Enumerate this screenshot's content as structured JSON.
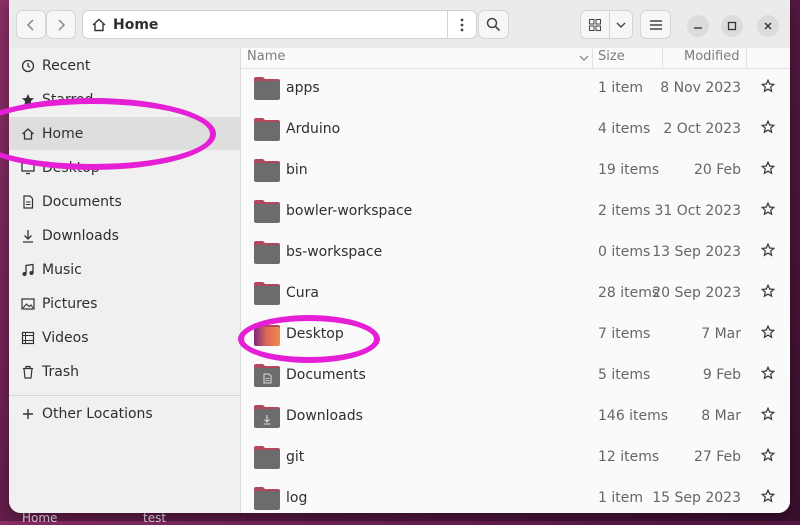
{
  "desktop": {
    "labels": [
      "Home",
      "test"
    ]
  },
  "header": {
    "title": "Home",
    "back_icon": "chevron-left-icon",
    "forward_icon": "chevron-right-icon",
    "search_icon": "search-icon",
    "view_icon": "grid-view-icon",
    "view_dropdown_icon": "chevron-down-icon",
    "menu_icon": "hamburger-icon",
    "window_controls": [
      "minimize",
      "maximize",
      "close"
    ]
  },
  "sidebar": {
    "items": [
      {
        "label": "Recent",
        "icon": "clock-icon"
      },
      {
        "label": "Starred",
        "icon": "star-icon"
      },
      {
        "label": "Home",
        "icon": "home-icon",
        "active": true
      },
      {
        "label": "Desktop",
        "icon": "desktop-icon"
      },
      {
        "label": "Documents",
        "icon": "document-icon"
      },
      {
        "label": "Downloads",
        "icon": "download-icon"
      },
      {
        "label": "Music",
        "icon": "music-icon"
      },
      {
        "label": "Pictures",
        "icon": "picture-icon"
      },
      {
        "label": "Videos",
        "icon": "video-icon"
      },
      {
        "label": "Trash",
        "icon": "trash-icon"
      }
    ],
    "other_locations": "Other Locations"
  },
  "list": {
    "columns": {
      "name": "Name",
      "size": "Size",
      "modified": "Modified"
    },
    "rows": [
      {
        "name": "apps",
        "size": "1 item",
        "modified": "8 Nov 2023",
        "kind": "folder"
      },
      {
        "name": "Arduino",
        "size": "4 items",
        "modified": "2 Oct 2023",
        "kind": "folder"
      },
      {
        "name": "bin",
        "size": "19 items",
        "modified": "20 Feb",
        "kind": "folder"
      },
      {
        "name": "bowler-workspace",
        "size": "2 items",
        "modified": "31 Oct 2023",
        "kind": "folder"
      },
      {
        "name": "bs-workspace",
        "size": "0 items",
        "modified": "13 Sep 2023",
        "kind": "folder"
      },
      {
        "name": "Cura",
        "size": "28 items",
        "modified": "20 Sep 2023",
        "kind": "folder"
      },
      {
        "name": "Desktop",
        "size": "7 items",
        "modified": "7 Mar",
        "kind": "desktop"
      },
      {
        "name": "Documents",
        "size": "5 items",
        "modified": "9 Feb",
        "kind": "documents"
      },
      {
        "name": "Downloads",
        "size": "146 items",
        "modified": "8 Mar",
        "kind": "downloads"
      },
      {
        "name": "git",
        "size": "12 items",
        "modified": "27 Feb",
        "kind": "folder"
      },
      {
        "name": "log",
        "size": "1 item",
        "modified": "15 Sep 2023",
        "kind": "folder"
      }
    ]
  },
  "colors": {
    "accent_highlight": "#e51fd5",
    "folder_body": "#6c6c6c",
    "folder_tab": "#b0495b"
  }
}
